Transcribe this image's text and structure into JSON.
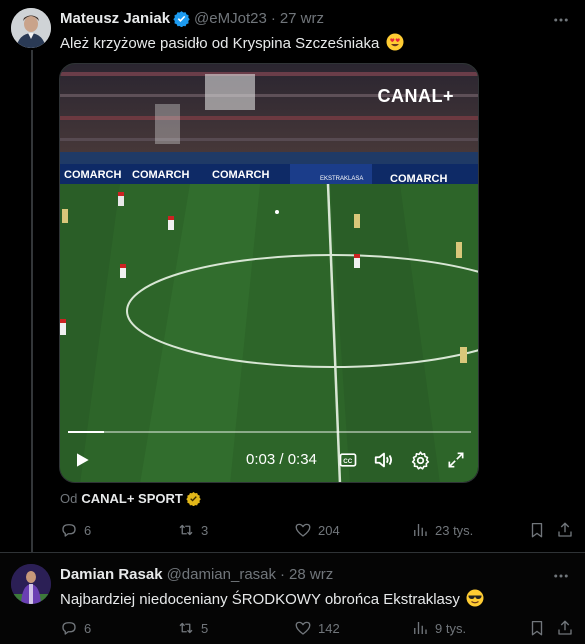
{
  "tweets": [
    {
      "name": "Mateusz Janiak",
      "handle": "@eMJot23",
      "separator": "·",
      "date": "27 wrz",
      "text": "Ależ krzyżowe pasidło od Kryspina Szcześniaka",
      "emoji": "heart-eyes-emoji",
      "video": {
        "brand_overlay": "CANAL+",
        "current_time": "0:03",
        "duration": "0:34",
        "time_display": "0:03 / 0:34",
        "progress": 0.09,
        "ad_boards": [
          "COMARCH",
          "COMARCH",
          "COMARCH",
          "EKSTRAKLASA",
          "COMARCH"
        ]
      },
      "source_prefix": "Od",
      "source_name": "CANAL+ SPORT",
      "replies": "6",
      "reposts": "3",
      "likes": "204",
      "views": "23 tys."
    },
    {
      "name": "Damian Rasak",
      "handle": "@damian_rasak",
      "separator": "·",
      "date": "28 wrz",
      "text": "Najbardziej niedoceniany ŚRODKOWY obrońca Ekstraklasy",
      "emoji": "sunglasses-emoji",
      "replies": "6",
      "reposts": "5",
      "likes": "142",
      "views": "9 tys."
    }
  ],
  "colors": {
    "background": "#000000",
    "text": "#e7e9ea",
    "muted": "#71767b",
    "verified_blue": "#1d9bf0",
    "verified_gold": "#e2b719",
    "pitch": "#2f6a2b"
  }
}
